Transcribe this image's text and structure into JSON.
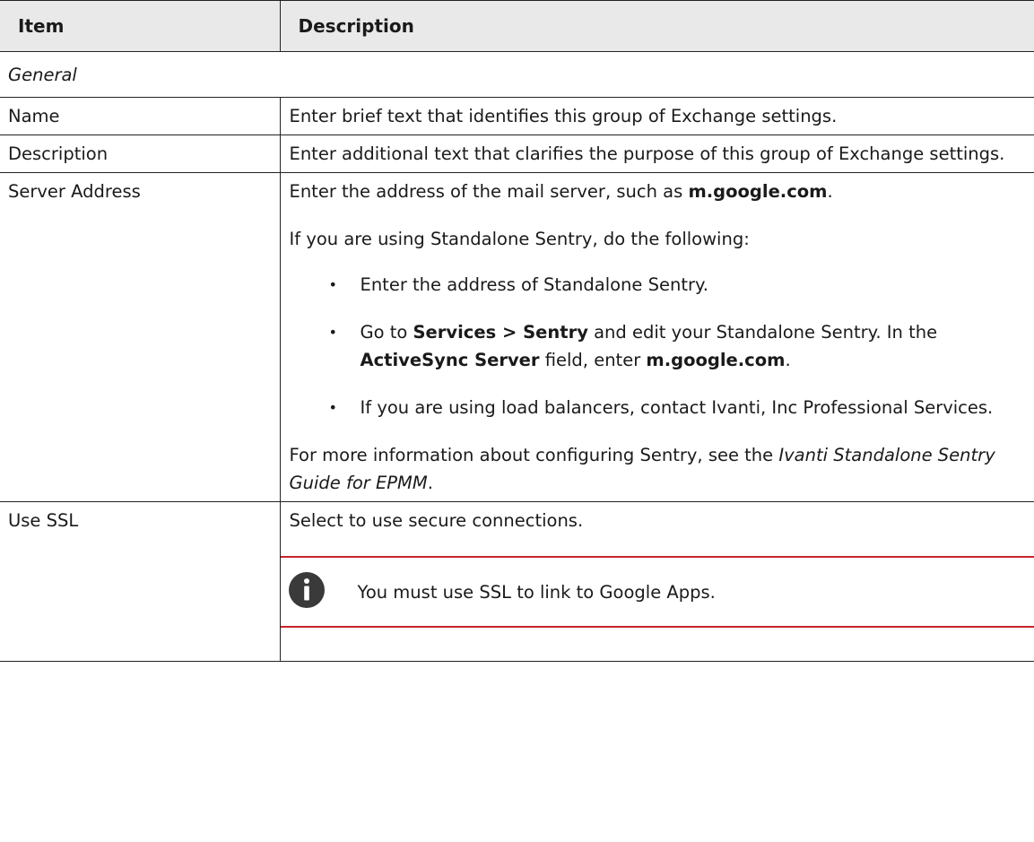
{
  "header": {
    "item": "Item",
    "description": "Description"
  },
  "general": {
    "label": "General"
  },
  "rows": {
    "name": {
      "item": "Name",
      "desc": "Enter brief text that identifies this group of Exchange settings."
    },
    "description": {
      "item": "Description",
      "desc": "Enter additional text that clarifies the purpose of this group of Exchange settings."
    },
    "server": {
      "item": "Server Address",
      "p1_pre": "Enter the address of the mail server, such as ",
      "p1_bold": "m.google.com",
      "p1_post": ".",
      "p2": "If you are using Standalone Sentry, do the following:",
      "b1": "Enter the address of Standalone Sentry.",
      "b2_pre": "Go to ",
      "b2_bold1": "Services > Sentry",
      "b2_mid": " and edit your Standalone Sentry. In the ",
      "b2_bold2": "ActiveSync Server",
      "b2_mid2": " field, enter ",
      "b2_bold3": "m.google.com",
      "b2_post": ".",
      "b3": "If you are using load balancers, contact Ivanti, Inc Professional Services.",
      "p3_pre": "For more information about configuring Sentry, see the ",
      "p3_italic": "Ivanti Standalone Sentry Guide for EPMM",
      "p3_post": "."
    },
    "ssl": {
      "item": "Use SSL",
      "desc": "Select to use secure connections.",
      "note": "You must use SSL to link to Google Apps."
    }
  },
  "colors": {
    "note_rule": "#c8232c",
    "header_bg": "#e9e9e9",
    "icon_bg": "#3a3a3a"
  },
  "icons": {
    "note": "info-icon",
    "bullet": "bullet-dot"
  }
}
